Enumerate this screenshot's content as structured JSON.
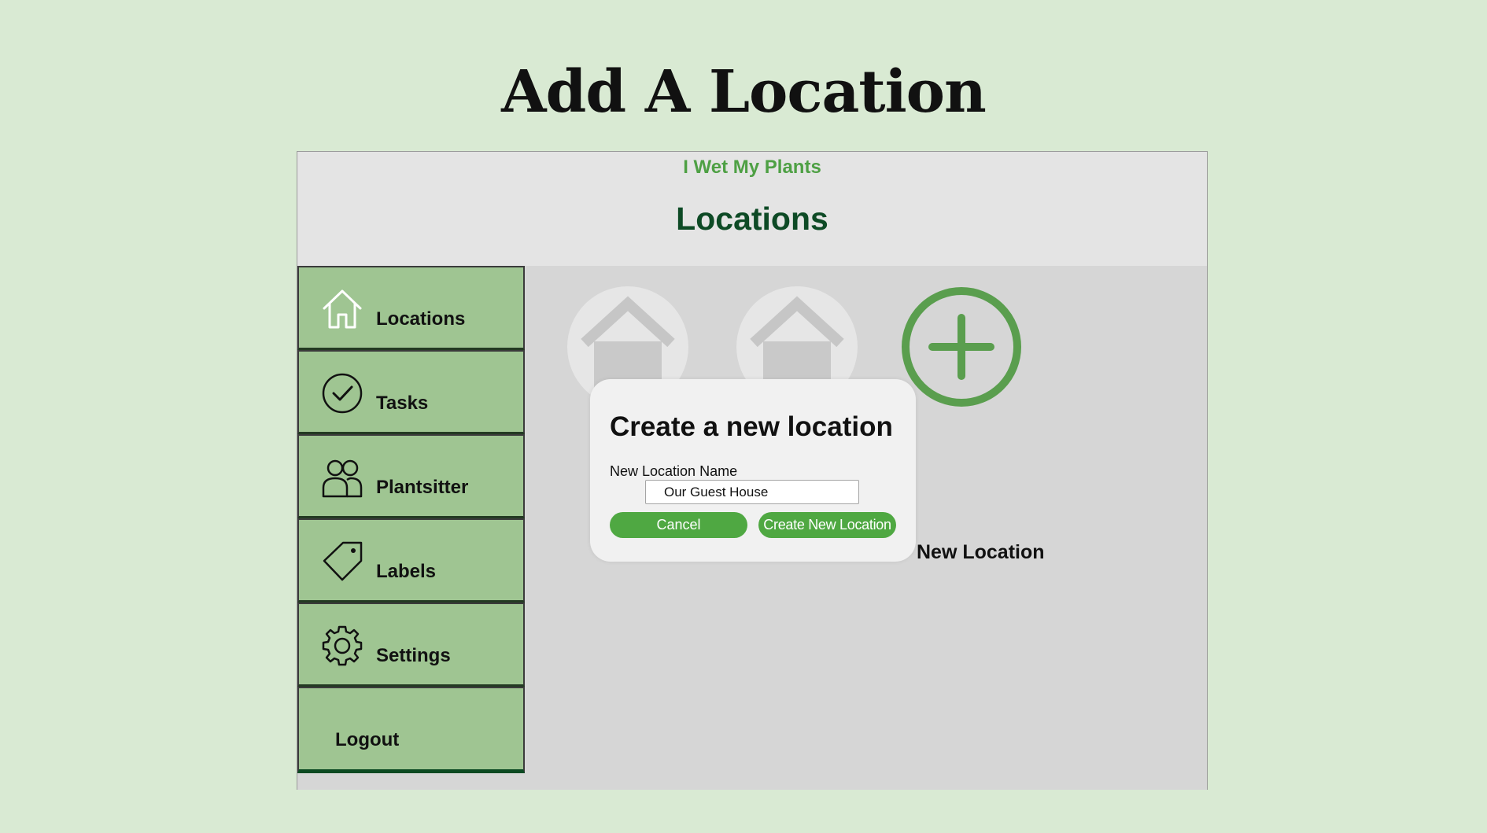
{
  "slide": {
    "title": "Add A Location"
  },
  "app": {
    "name": "I Wet My Plants",
    "page_title": "Locations"
  },
  "sidebar": {
    "items": [
      {
        "label": "Locations",
        "icon": "home-icon"
      },
      {
        "label": "Tasks",
        "icon": "check-circle-icon"
      },
      {
        "label": "Plantsitter",
        "icon": "users-icon"
      },
      {
        "label": "Labels",
        "icon": "tag-icon"
      },
      {
        "label": "Settings",
        "icon": "gear-icon"
      },
      {
        "label": "Logout",
        "icon": ""
      }
    ]
  },
  "locations": {
    "new_location_label": "New Location",
    "tiles": [
      {
        "icon": "house-icon"
      },
      {
        "icon": "house-icon"
      },
      {
        "icon": "plus-circle-icon"
      }
    ]
  },
  "modal": {
    "title": "Create a new location",
    "field_label": "New Location Name",
    "input_value": "Our Guest House",
    "cancel_label": "Cancel",
    "create_label": "Create New Location"
  },
  "colors": {
    "background": "#d9ead3",
    "accent_green": "#4fa842",
    "dark_green": "#0d4a25",
    "sidebar_green": "#9fc592"
  }
}
